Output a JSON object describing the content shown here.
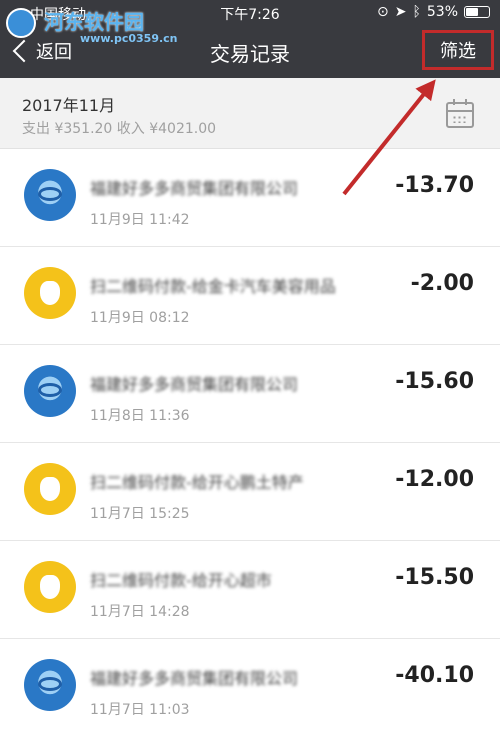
{
  "status_bar": {
    "carrier": "中国移动",
    "time": "下午7:26",
    "battery": "53%",
    "battery_level": 0.53
  },
  "watermark": {
    "title": "河东软件园",
    "url": "www.pc0359.cn"
  },
  "nav": {
    "back_label": "返回",
    "title": "交易记录",
    "filter_label": "筛选"
  },
  "summary": {
    "month": "2017年11月",
    "totals": "支出 ¥351.20 收入 ¥4021.00"
  },
  "transactions": [
    {
      "merchant": "福建好多多商贸集团有限公司",
      "datetime": "11月9日 11:42",
      "amount": "-13.70",
      "icon": "blue-circle-icon"
    },
    {
      "merchant": "扫二维码付款-给金卡汽车美容用品",
      "datetime": "11月9日 08:12",
      "amount": "-2.00",
      "icon": "yellow-pouch-icon"
    },
    {
      "merchant": "福建好多多商贸集团有限公司",
      "datetime": "11月8日 11:36",
      "amount": "-15.60",
      "icon": "blue-circle-icon"
    },
    {
      "merchant": "扫二维码付款-给开心鹏土特产",
      "datetime": "11月7日 15:25",
      "amount": "-12.00",
      "icon": "yellow-pouch-icon"
    },
    {
      "merchant": "扫二维码付款-给开心超市",
      "datetime": "11月7日 14:28",
      "amount": "-15.50",
      "icon": "yellow-stopwatch-icon"
    },
    {
      "merchant": "福建好多多商贸集团有限公司",
      "datetime": "11月7日 11:03",
      "amount": "-40.10",
      "icon": "blue-circle-icon"
    }
  ],
  "colors": {
    "header_bg": "#393a3f",
    "highlight_red": "#c32b2b",
    "wechat_blue": "#2a78c6",
    "yellow": "#f4c21a"
  }
}
